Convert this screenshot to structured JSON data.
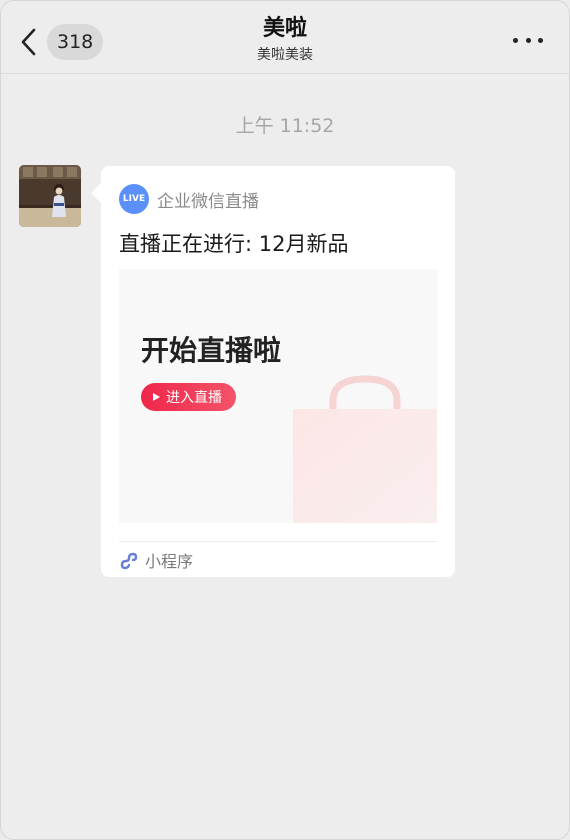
{
  "header": {
    "back_icon": "chevron-left-icon",
    "unread_count": "318",
    "title": "美啦",
    "subtitle": "美啦美装",
    "more_icon": "more-dots-icon"
  },
  "chat": {
    "timestamp": "上午 11:52"
  },
  "message": {
    "source_badge": "LIVE",
    "source_name": "企业微信直播",
    "title": "直播正在进行: 12月新品",
    "preview": {
      "heading": "开始直播啦",
      "button_label": "进入直播",
      "button_icon": "play-icon"
    },
    "footer_icon": "mini-program-icon",
    "footer_label": "小程序"
  },
  "colors": {
    "background": "#ededed",
    "card": "#ffffff",
    "live_badge": "#5b8ff9",
    "accent_red": "#f0264a",
    "muted_text": "#a6a6a6"
  }
}
